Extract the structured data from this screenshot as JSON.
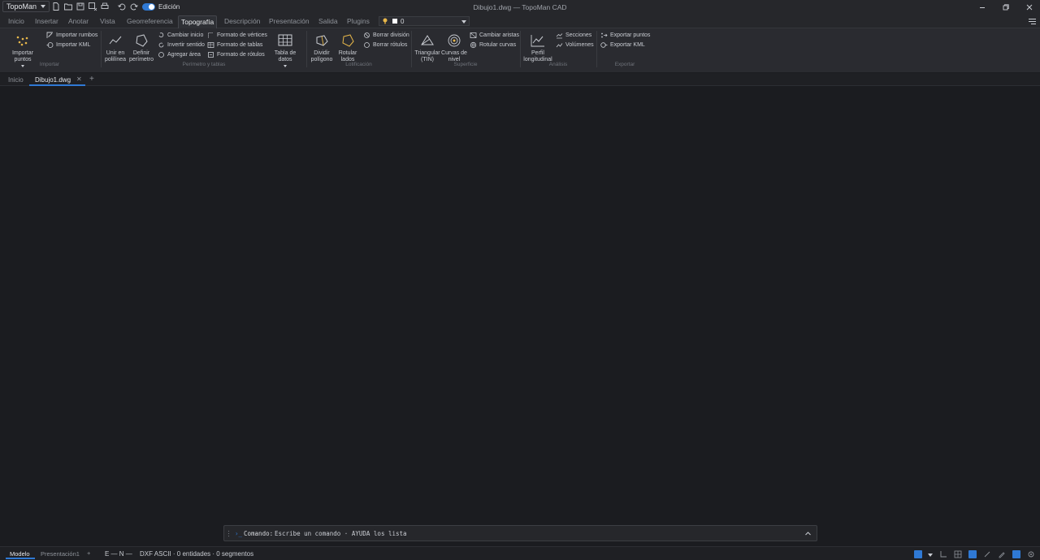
{
  "window": {
    "app_menu": "TopoMan",
    "title": "Dibujo1.dwg — TopoMan CAD",
    "edit_mode_label": "Edición"
  },
  "ribbon_tabs": [
    "Inicio",
    "Insertar",
    "Anotar",
    "Vista",
    "Georreferencia",
    "Topografía",
    "Descripción",
    "Presentación",
    "Salida",
    "Plugins"
  ],
  "active_ribbon_tab": "Topografía",
  "layer": {
    "name": "0",
    "color": "#ffffff"
  },
  "ribbon": {
    "importar": {
      "group": "Importar",
      "import_points": "Importar puntos",
      "import_bearings": "Importar rumbos",
      "import_kml": "Importar KML"
    },
    "perimetro": {
      "group": "Perímetro y tablas",
      "join_line1": "Unir en",
      "join_line2": "polilínea",
      "define_line1": "Definir",
      "define_line2": "perímetro",
      "change_start": "Cambiar inicio",
      "reverse": "Invertir sentido",
      "add_area": "Agregar área",
      "vertex_format": "Formato de vértices",
      "table_format": "Formato de tablas",
      "label_format": "Formato de rótulos",
      "data_table": "Tabla de datos"
    },
    "lotificacion": {
      "group": "Lotificación",
      "divide_line1": "Dividir",
      "divide_line2": "polígono",
      "label_sides_line1": "Rotular",
      "label_sides_line2": "lados",
      "delete_division": "Borrar división",
      "delete_labels": "Borrar rótulos"
    },
    "superficie": {
      "group": "Superficie",
      "tin_line1": "Triangular",
      "tin_line2": "(TIN)",
      "contours_line1": "Curvas de",
      "contours_line2": "nivel",
      "change_edges": "Cambiar aristas",
      "label_contours": "Rotular curvas"
    },
    "analisis": {
      "group": "Análisis",
      "profile_line1": "Perfil",
      "profile_line2": "longitudinal",
      "sections": "Secciones",
      "volumes": "Volúmenes"
    },
    "exportar": {
      "group": "Exportar",
      "export_points": "Exportar puntos",
      "export_kml": "Exportar KML"
    }
  },
  "doc_tabs": {
    "home": "Inicio",
    "active": "Dibujo1.dwg",
    "close": "✕",
    "add": "+"
  },
  "command": {
    "prompt": "›_",
    "label": "Comando:",
    "placeholder": "Escribe un comando · AYUDA los lista"
  },
  "status": {
    "model_tab": "Modelo",
    "layout_tab": "Presentación1",
    "add_layout": "+",
    "coords": "E — N —",
    "info": "DXF ASCII · 0 entidades · 0 segmentos"
  },
  "colors": {
    "accent": "#2f79d4",
    "background": "#1b1c20",
    "ribbon": "#2a2b30"
  }
}
